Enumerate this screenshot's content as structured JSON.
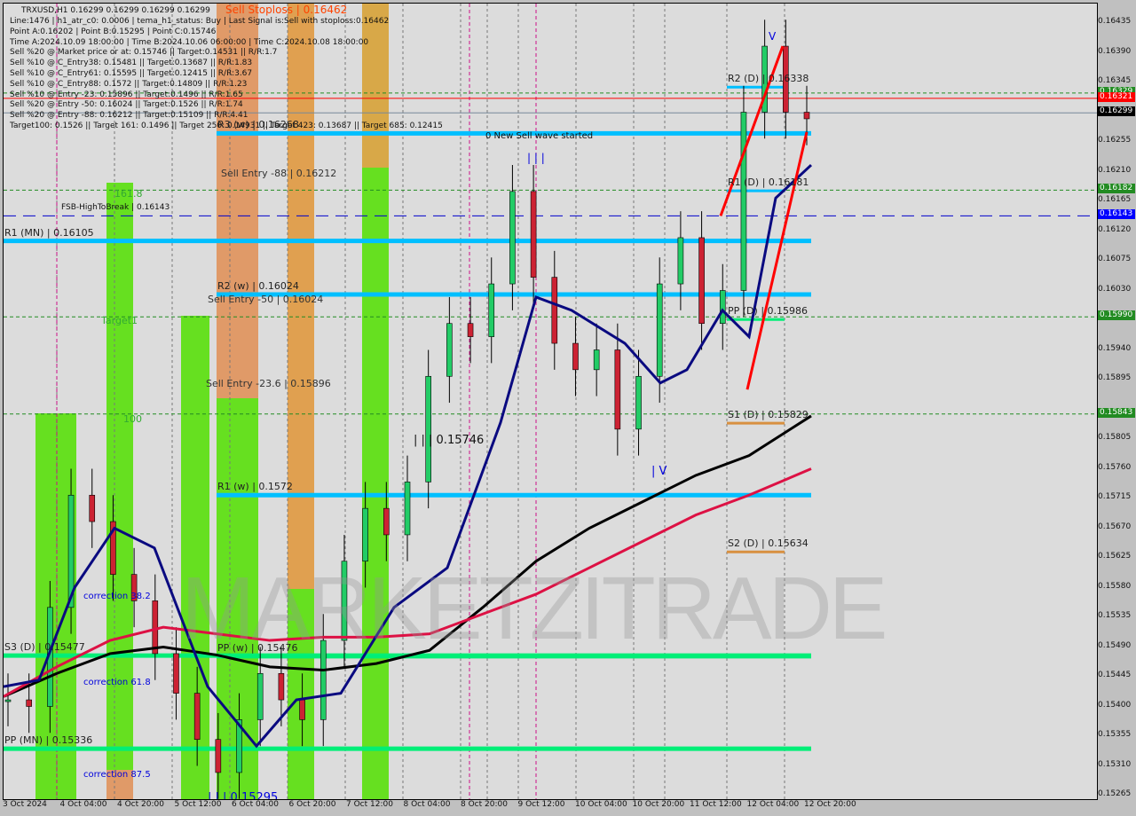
{
  "chart_data": {
    "type": "candlestick",
    "symbol": "TRXUSD",
    "timeframe": "H1",
    "ohlc_header": "TRXUSD,H1  0.16299 0.16299 0.16299 0.16299",
    "ylim": [
      0.15265,
      0.16435
    ],
    "y_ticks": [
      "0.16435",
      "0.16390",
      "0.16345",
      "0.16255",
      "0.16210",
      "0.16165",
      "0.16120",
      "0.16075",
      "0.16030",
      "0.15940",
      "0.15895",
      "0.15805",
      "0.15760",
      "0.15715",
      "0.15670",
      "0.15625",
      "0.15580",
      "0.15535",
      "0.15490",
      "0.15445",
      "0.15400",
      "0.15355",
      "0.15310",
      "0.15265"
    ],
    "x_ticks": [
      "3 Oct 2024",
      "4 Oct 04:00",
      "4 Oct 20:00",
      "5 Oct 12:00",
      "6 Oct 04:00",
      "6 Oct 20:00",
      "7 Oct 12:00",
      "8 Oct 04:00",
      "8 Oct 20:00",
      "9 Oct 12:00",
      "10 Oct 04:00",
      "10 Oct 20:00",
      "11 Oct 12:00",
      "12 Oct 04:00",
      "12 Oct 20:00"
    ],
    "info_lines": [
      "Line:1476 | h1_atr_c0: 0.0006 | tema_h1_status: Buy | Last Signal is:Sell with stoploss:0.16462",
      "Point A:0.16202 | Point B:0.15295 | Point C:0.15746",
      "Time A:2024.10.09 18:00:00 | Time B:2024.10.06 06:00:00 | Time C:2024.10.08 18:00:00",
      "Sell %20 @ Market price or at: 0.15746 || Target:0.14531 || R/R:1.7",
      "Sell %10 @ C_Entry38: 0.15481 || Target:0.13687 || R/R:1.83",
      "Sell %10 @ C_Entry61: 0.15595 || Target:0.12415 || R/R:3.67",
      "Sell %10 @ C_Entry88: 0.1572 || Target:0.14809 || R/R:1.23",
      "Sell %10 @ Entry -23: 0.15896 || Target:0.1496 || R/R:1.65",
      "Sell %20 @ Entry -50: 0.16024 || Target:0.1526 || R/R:1.74",
      "Sell %20 @ Entry -88: 0.16212 || Target:0.15109 || R/R:4.41",
      "Target100: 0.1526 || Target 161: 0.1496 || Target 250: 0.14931 || Target 423: 0.13687 || Target 685: 0.12415"
    ],
    "levels": [
      {
        "label": "R2 (D) | 0.16338",
        "value": 0.16338,
        "color": "#00bfff"
      },
      {
        "label": "R3 (w) | 0.16268",
        "value": 0.16268,
        "color": "#00bfff"
      },
      {
        "label": "R1 (D) | 0.16181",
        "value": 0.16181,
        "color": "#00bfff"
      },
      {
        "label": "R1 (MN) | 0.16105",
        "value": 0.16105,
        "color": "#00bfff"
      },
      {
        "label": "R2 (w) | 0.16024",
        "value": 0.16024,
        "color": "#00bfff"
      },
      {
        "label": "PP (D) | 0.15986",
        "value": 0.15986,
        "color": "#00ee77"
      },
      {
        "label": "S1 (D) | 0.15829",
        "value": 0.15829,
        "color": "#d89040"
      },
      {
        "label": "R1 (w) | 0.1572",
        "value": 0.1572,
        "color": "#00bfff"
      },
      {
        "label": "S2 (D) | 0.15634",
        "value": 0.15634,
        "color": "#d89040"
      },
      {
        "label": "PP (w) | 0.15476",
        "value": 0.15476,
        "color": "#00ee77"
      },
      {
        "label": "S3 (D) | 0.15477",
        "value": 0.15477,
        "color": "#00ee77"
      },
      {
        "label": "PP (MN) | 0.15336",
        "value": 0.15336,
        "color": "#00ee77"
      }
    ],
    "annotations": [
      "Sell Stoploss | 0.16462",
      "Sell Entry -88 | 0.16212",
      "Sell Entry -50 | 0.16024",
      "Sell Entry -23.6 | 0.15896",
      "FSB-HighToBreak | 0.16143",
      "0 New Sell wave started",
      "161.8",
      "Target1",
      "100",
      "correction 38.2",
      "correction 61.8",
      "correction 87.5",
      "| | | 0.15746",
      "| | | 0.15295",
      "| | |",
      "| V",
      "V"
    ],
    "price_tags": [
      {
        "value": "0.16329",
        "bg": "#228b22"
      },
      {
        "value": "0.16321",
        "bg": "#ff0000"
      },
      {
        "value": "0.16299",
        "bg": "#000000"
      },
      {
        "value": "0.16182",
        "bg": "#228b22"
      },
      {
        "value": "0.16143",
        "bg": "#0000ff"
      },
      {
        "value": "0.15990",
        "bg": "#228b22"
      },
      {
        "value": "0.15843",
        "bg": "#228b22"
      }
    ],
    "series_close_approx": [
      0.1541,
      0.154,
      0.1555,
      0.1572,
      0.1568,
      0.156,
      0.1556,
      0.1548,
      0.1542,
      0.1535,
      0.153,
      0.1538,
      0.1545,
      0.1541,
      0.1538,
      0.155,
      0.1562,
      0.157,
      0.1566,
      0.1574,
      0.159,
      0.1598,
      0.1596,
      0.1604,
      0.1618,
      0.1605,
      0.1595,
      0.1591,
      0.1594,
      0.1582,
      0.159,
      0.1604,
      0.1611,
      0.1598,
      0.1603,
      0.163,
      0.164,
      0.163,
      0.1629
    ],
    "watermark": "MARKETZITRADE"
  }
}
